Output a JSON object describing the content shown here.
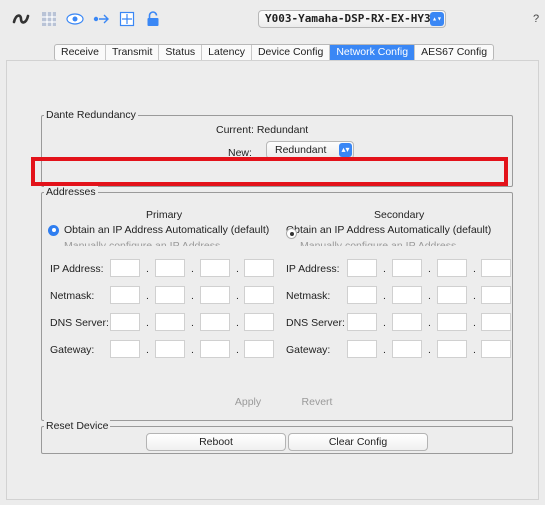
{
  "toolbar": {
    "icons": [
      "dante-logo-icon",
      "routing-grid-icon",
      "eye-icon",
      "network-icon",
      "plus-box-icon",
      "lock-icon"
    ],
    "device_name": "Y003-Yamaha-DSP-RX-EX-HY3",
    "help": "?"
  },
  "tabs": [
    "Receive",
    "Transmit",
    "Status",
    "Latency",
    "Device Config",
    "Network Config",
    "AES67 Config"
  ],
  "active_tab": "Network Config",
  "dante_redundancy": {
    "title": "Dante Redundancy",
    "current": "Current: Redundant",
    "new_label": "New:",
    "new_value": "Redundant"
  },
  "addresses": {
    "title": "Addresses",
    "primary": {
      "title": "Primary",
      "auto_option": "Obtain an IP Address Automatically (default)",
      "manual_option": "Manually configure an IP Address",
      "fields": [
        "IP Address:",
        "Netmask:",
        "DNS Server:",
        "Gateway:"
      ]
    },
    "secondary": {
      "title": "Secondary",
      "auto_option": "Obtain an IP Address Automatically (default)",
      "manual_option": "Manually configure an IP Address",
      "fields": [
        "IP Address:",
        "Netmask:",
        "DNS Server:",
        "Gateway:"
      ]
    },
    "apply_label": "Apply",
    "revert_label": "Revert"
  },
  "reset_device": {
    "title": "Reset Device",
    "reboot_label": "Reboot",
    "clear_config_label": "Clear Config"
  },
  "colors": {
    "accent": "#3a87f5",
    "highlight": "#e3121a"
  }
}
